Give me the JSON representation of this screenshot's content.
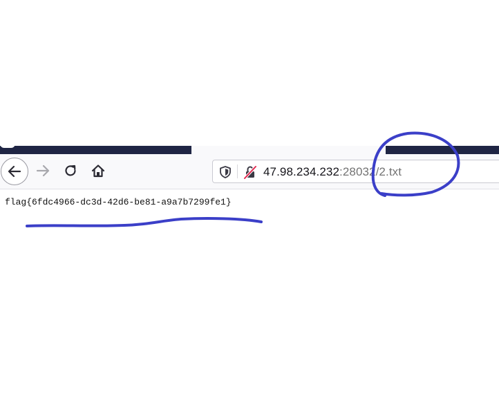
{
  "browser": {
    "toolbar": {
      "back_icon": "arrow-left-icon",
      "forward_icon": "arrow-right-icon",
      "reload_icon": "reload-icon",
      "home_icon": "home-icon"
    },
    "urlbar": {
      "shield_icon": "shield-icon",
      "lock_icon": "insecure-lock-icon",
      "host": "47.98.234.232",
      "rest": ":28032/2.txt"
    }
  },
  "page": {
    "text": "flag{6fdc4966-dc3d-42d6-be81-a9a7b7299fe1}"
  },
  "annotations": {
    "color": "#3b3fc8"
  }
}
